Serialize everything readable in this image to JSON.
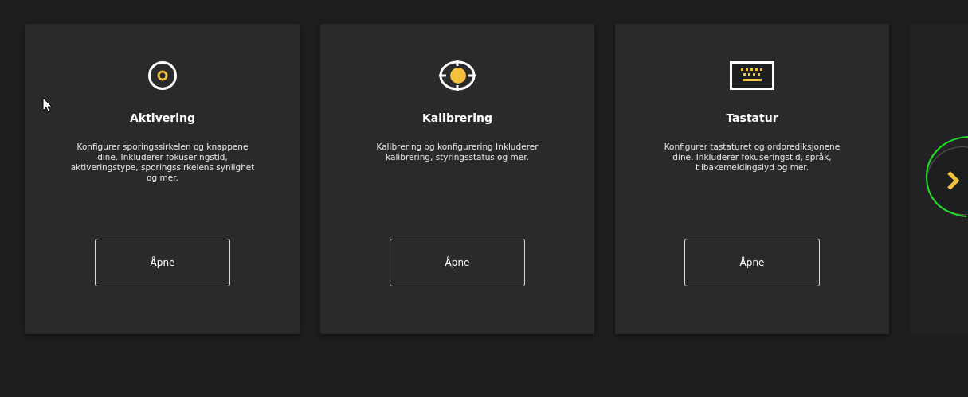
{
  "cards": [
    {
      "title": "Aktivering",
      "description": "Konfigurer sporingssirkelen og knappene dine. Inkluderer fokuseringstid, aktiveringstype, sporingssirkelens synlighet og mer.",
      "button": "Åpne"
    },
    {
      "title": "Kalibrering",
      "description": "Kalibrering og konfigurering Inkluderer kalibrering, styringsstatus og mer.",
      "button": "Åpne"
    },
    {
      "title": "Tastatur",
      "description": "Konfigurer tastaturet og ordprediksjonene dine. Inkluderer fokuseringstid, språk, tilbakemeldingslyd og mer.",
      "button": "Åpne"
    }
  ]
}
